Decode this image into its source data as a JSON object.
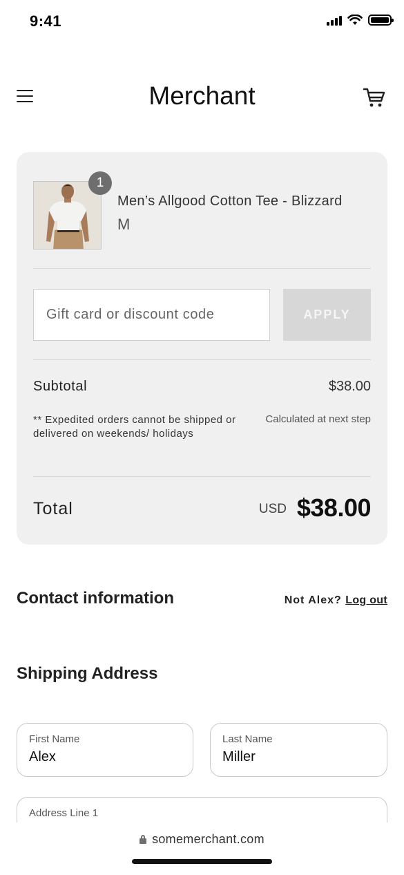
{
  "status_bar": {
    "time": "9:41"
  },
  "header": {
    "brand": "Merchant"
  },
  "order_summary": {
    "item": {
      "quantity": "1",
      "name": "Men’s Allgood Cotton Tee - Blizzard",
      "variant": "M"
    },
    "discount": {
      "placeholder": "Gift card or discount code",
      "value": "",
      "apply_label": "APPLY"
    },
    "subtotal_label": "Subtotal",
    "subtotal_value": "$38.00",
    "shipping_note": "** Expedited orders cannot be shipped or delivered on weekends/ holidays",
    "shipping_value": "Calculated at next step",
    "total_label": "Total",
    "total_currency": "USD",
    "total_value": "$38.00"
  },
  "contact": {
    "title": "Contact information",
    "not_user": "Not Alex?",
    "logout_label": "Log out"
  },
  "shipping": {
    "title": "Shipping Address",
    "first_name": {
      "label": "First Name",
      "value": "Alex"
    },
    "last_name": {
      "label": "Last Name",
      "value": "Miller"
    },
    "address_line_1": {
      "label": "Address Line 1",
      "value": ""
    }
  },
  "browser": {
    "url": "somemerchant.com"
  },
  "icons": [
    "signal-icon",
    "wifi-icon",
    "battery-icon",
    "menu-icon",
    "cart-icon",
    "lock-icon"
  ],
  "colors": {
    "card_background": "#f0f0f0",
    "badge": "#6e6e6e",
    "apply_disabled": "#d7d7d7"
  }
}
